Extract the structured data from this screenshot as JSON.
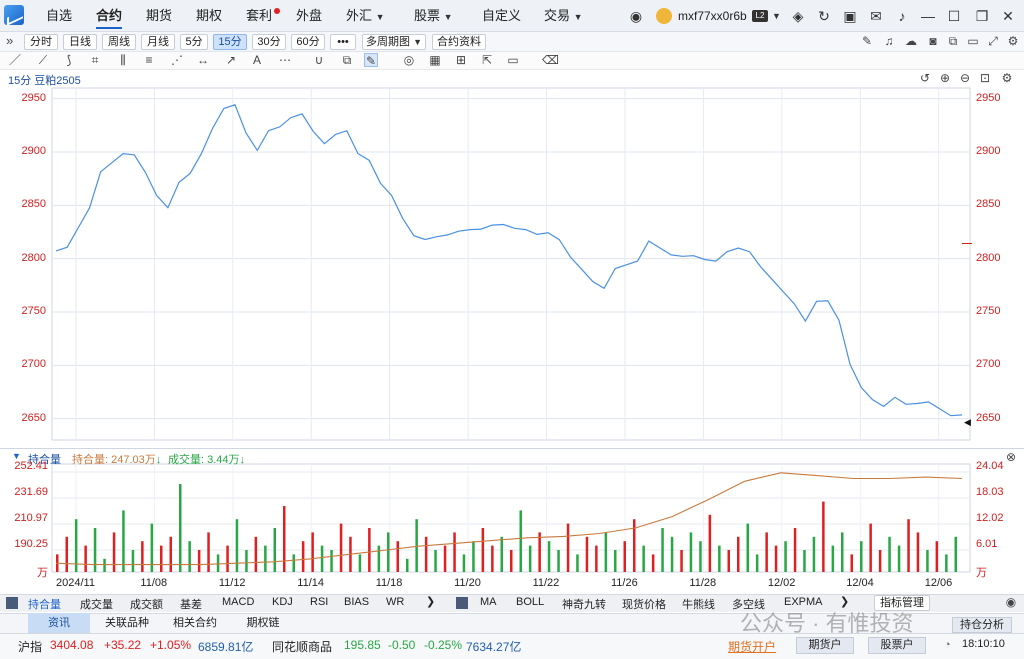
{
  "menu": {
    "items": [
      "自选",
      "合约",
      "期货",
      "期权",
      "套利",
      "外盘",
      "外汇",
      "股票",
      "自定义",
      "交易"
    ],
    "account": "mxf77xx0r6b"
  },
  "toolbar": {
    "expand": "»",
    "periods": [
      "分时",
      "日线",
      "周线",
      "月线",
      "5分",
      "15分",
      "30分",
      "60分"
    ],
    "selected_period": "15分",
    "more": "•••",
    "multi": "多周期图",
    "info": "合约资料"
  },
  "chart_header": {
    "title": "15分 豆粕2505"
  },
  "chart_data": [
    {
      "type": "line",
      "title": "15分 豆粕2505",
      "y_ticks": [
        "2950",
        "2900",
        "2850",
        "2800",
        "2750",
        "2700",
        "2650"
      ],
      "ylim": [
        2630,
        2960
      ],
      "x_ticks": [
        "2024/11",
        "11/08",
        "11/12",
        "11/14",
        "11/18",
        "11/20",
        "11/22",
        "11/26",
        "11/28",
        "12/02",
        "12/04",
        "12/06"
      ],
      "grid": true,
      "values": [
        2805,
        2810,
        2830,
        2850,
        2880,
        2890,
        2900,
        2895,
        2880,
        2860,
        2850,
        2870,
        2880,
        2900,
        2920,
        2940,
        2945,
        2920,
        2900,
        2920,
        2925,
        2930,
        2935,
        2920,
        2910,
        2915,
        2920,
        2900,
        2890,
        2870,
        2860,
        2840,
        2820,
        2818,
        2822,
        2820,
        2825,
        2828,
        2830,
        2830,
        2832,
        2830,
        2825,
        2822,
        2825,
        2820,
        2800,
        2790,
        2780,
        2770,
        2790,
        2795,
        2800,
        2815,
        2810,
        2805,
        2800,
        2802,
        2800,
        2800,
        2805,
        2810,
        2808,
        2790,
        2780,
        2770,
        2760,
        2740,
        2760,
        2762,
        2740,
        2700,
        2680,
        2670,
        2660,
        2670,
        2665,
        2662,
        2665,
        2660,
        2655,
        2652
      ]
    },
    {
      "type": "bar",
      "title": "持合量",
      "legend": [
        "持合量: 247.03万",
        "成交量: 3.44万"
      ],
      "y_ticks_left": [
        "252.41",
        "231.69",
        "210.97",
        "190.25",
        "万"
      ],
      "y_ticks_right": [
        "24.04",
        "18.03",
        "12.02",
        "6.01",
        "万"
      ],
      "x_ticks": [
        "2024/11",
        "11/08",
        "11/12",
        "11/14",
        "11/18",
        "11/20",
        "11/22",
        "11/26",
        "11/28",
        "12/02",
        "12/04",
        "12/06"
      ],
      "open_interest_line": [
        187,
        186,
        186,
        186,
        186,
        187,
        188,
        190,
        193,
        196,
        199,
        201,
        203,
        205,
        206,
        208,
        212,
        220,
        232,
        245,
        251,
        249,
        247,
        247,
        248,
        247
      ],
      "volume_bars": [
        4,
        8,
        12,
        6,
        10,
        3,
        9,
        14,
        5,
        7,
        11,
        6,
        8,
        20,
        7,
        5,
        9,
        4,
        6,
        12,
        5,
        8,
        6,
        10,
        15,
        4,
        7,
        9,
        6,
        5,
        11,
        8,
        4,
        10,
        6,
        9,
        7,
        3,
        12,
        8,
        5,
        6,
        9,
        4,
        7,
        10,
        6,
        8,
        5,
        14,
        6,
        9,
        7,
        5,
        11,
        4,
        8,
        6,
        9,
        5,
        7,
        12,
        6,
        4,
        10,
        8,
        5,
        9,
        7,
        13,
        6,
        5,
        8,
        11,
        4,
        9,
        6,
        7,
        10,
        5,
        8,
        16,
        6,
        9,
        4,
        7,
        11,
        5,
        8,
        6,
        12,
        9,
        5,
        7,
        4,
        8
      ]
    }
  ],
  "indicators_left": [
    "持合量",
    "成交量",
    "成交额",
    "基差",
    "MACD",
    "KDJ",
    "RSI",
    "BIAS",
    "WR"
  ],
  "indicators_right": [
    "MA",
    "BOLL",
    "神奇九转",
    "现货价格",
    "牛熊线",
    "多空线",
    "EXPMA"
  ],
  "indicator_manage": "指标管理",
  "footer_tabs": [
    "资讯",
    "关联品种",
    "相关合约",
    "期权链"
  ],
  "status": {
    "index_name": "沪指",
    "index_value": "3404.08",
    "index_change": "+35.22",
    "index_pct": "+1.05%",
    "index_amount": "6859.81亿",
    "board_name": "同花顺商品",
    "board_value": "195.85",
    "board_change": "-0.50",
    "board_pct": "-0.25%",
    "board_amount": "7634.27亿",
    "open_account": "期货开户",
    "futures_user": "期货户",
    "stock_user": "股票户",
    "analysis": "持仓分析",
    "time": "18:10:10",
    "watermark": "公众号 · 有惟投资"
  },
  "colors": {
    "accent": "#1a63c9",
    "price_line": "#4a90e2",
    "axis_red": "#d02020",
    "oi_line": "#c87a3c",
    "up": "#e02020",
    "down": "#28a745"
  }
}
